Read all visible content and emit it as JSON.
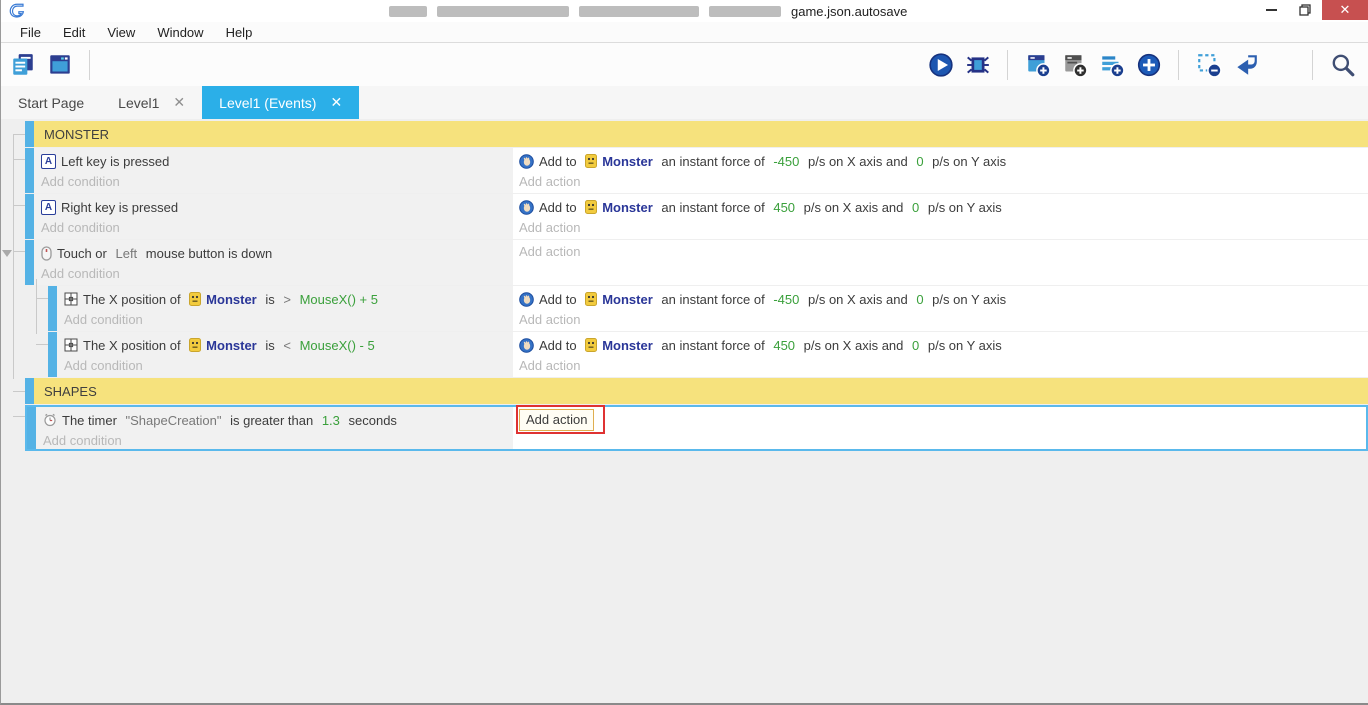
{
  "window": {
    "title_visible": "game.json.autosave",
    "controls": [
      {
        "name": "minimize-button",
        "glyph": "minimize"
      },
      {
        "name": "restore-button",
        "glyph": "restore"
      },
      {
        "name": "close-button",
        "glyph": "close",
        "label": "✕",
        "color": "#c75050"
      }
    ]
  },
  "menu": [
    "File",
    "Edit",
    "View",
    "Window",
    "Help"
  ],
  "toolbar": {
    "left_icons": [
      "project-manager-icon",
      "scene-editor-icon"
    ],
    "right_groups": [
      [
        "play-icon",
        "debug-icon"
      ],
      [
        "add-event-icon",
        "add-subevent-icon",
        "add-comment-icon",
        "add-circle-icon"
      ],
      [
        "remove-selection-icon",
        "undo-icon",
        "redo-icon"
      ],
      [
        "search-icon"
      ]
    ]
  },
  "tabs": [
    {
      "label": "Start Page",
      "closable": false,
      "active": false
    },
    {
      "label": "Level1",
      "closable": true,
      "active": false
    },
    {
      "label": "Level1 (Events)",
      "closable": true,
      "active": true
    }
  ],
  "placeholders": {
    "condition": "Add condition",
    "action": "Add action"
  },
  "colors": {
    "accent_blue": "#2bafe8",
    "event_bar_blue": "#54b2e5",
    "group_yellow": "#f6e27d",
    "value_green": "#3aa03b",
    "object_blue": "#2a3698",
    "annotation_red": "#df3232",
    "close_red": "#c75050"
  },
  "events": {
    "rows": [
      {
        "kind": "group",
        "label": "MONSTER",
        "indent": 0
      },
      {
        "kind": "event",
        "indent": 0,
        "condition": {
          "lines": [
            [
              {
                "icon": "keyboard-a-icon"
              },
              {
                "t": "Left key is pressed"
              }
            ]
          ]
        },
        "action": {
          "lines": [
            [
              {
                "icon": "force-icon"
              },
              {
                "t": "Add to "
              },
              {
                "icon": "monster-icon"
              },
              {
                "t": "Monster",
                "s": "object"
              },
              {
                "t": " an instant force of "
              },
              {
                "t": "-450",
                "s": "value"
              },
              {
                "t": " p/s on X axis and "
              },
              {
                "t": "0",
                "s": "value"
              },
              {
                "t": " p/s on Y axis"
              }
            ]
          ]
        }
      },
      {
        "kind": "event",
        "indent": 0,
        "condition": {
          "lines": [
            [
              {
                "icon": "keyboard-a-icon"
              },
              {
                "t": "Right key is pressed"
              }
            ]
          ]
        },
        "action": {
          "lines": [
            [
              {
                "icon": "force-icon"
              },
              {
                "t": "Add to "
              },
              {
                "icon": "monster-icon"
              },
              {
                "t": "Monster",
                "s": "object"
              },
              {
                "t": " an instant force of "
              },
              {
                "t": "450",
                "s": "value"
              },
              {
                "t": " p/s on X axis and "
              },
              {
                "t": "0",
                "s": "value"
              },
              {
                "t": " p/s on Y axis"
              }
            ]
          ]
        }
      },
      {
        "kind": "event",
        "indent": 0,
        "has_children": true,
        "condition": {
          "lines": [
            [
              {
                "icon": "mouse-icon"
              },
              {
                "t": "Touch or "
              },
              {
                "t": "Left",
                "s": "param"
              },
              {
                "t": " mouse button is down"
              }
            ]
          ]
        },
        "action": {
          "lines": []
        }
      },
      {
        "kind": "event",
        "indent": 1,
        "condition": {
          "lines": [
            [
              {
                "icon": "position-icon"
              },
              {
                "t": "The X position of "
              },
              {
                "icon": "monster-icon"
              },
              {
                "t": "Monster",
                "s": "object"
              },
              {
                "t": " is "
              },
              {
                "t": "> ",
                "s": "param"
              },
              {
                "t": "MouseX() + 5",
                "s": "value"
              }
            ]
          ]
        },
        "action": {
          "lines": [
            [
              {
                "icon": "force-icon"
              },
              {
                "t": "Add to "
              },
              {
                "icon": "monster-icon"
              },
              {
                "t": "Monster",
                "s": "object"
              },
              {
                "t": " an instant force of "
              },
              {
                "t": "-450",
                "s": "value"
              },
              {
                "t": " p/s on X axis and "
              },
              {
                "t": "0",
                "s": "value"
              },
              {
                "t": " p/s on Y axis"
              }
            ]
          ]
        }
      },
      {
        "kind": "event",
        "indent": 1,
        "condition": {
          "lines": [
            [
              {
                "icon": "position-icon"
              },
              {
                "t": "The X position of "
              },
              {
                "icon": "monster-icon"
              },
              {
                "t": "Monster",
                "s": "object"
              },
              {
                "t": " is "
              },
              {
                "t": "< ",
                "s": "param"
              },
              {
                "t": "MouseX() - 5",
                "s": "value"
              }
            ]
          ]
        },
        "action": {
          "lines": [
            [
              {
                "icon": "force-icon"
              },
              {
                "t": "Add to "
              },
              {
                "icon": "monster-icon"
              },
              {
                "t": "Monster",
                "s": "object"
              },
              {
                "t": " an instant force of "
              },
              {
                "t": "450",
                "s": "value"
              },
              {
                "t": " p/s on X axis and "
              },
              {
                "t": "0",
                "s": "value"
              },
              {
                "t": " p/s on Y axis"
              }
            ]
          ]
        }
      },
      {
        "kind": "group",
        "label": "SHAPES",
        "indent": 0
      },
      {
        "kind": "event",
        "indent": 0,
        "selected": true,
        "focused_action": true,
        "annotated": true,
        "condition": {
          "lines": [
            [
              {
                "icon": "timer-icon"
              },
              {
                "t": "The timer "
              },
              {
                "t": "\"ShapeCreation\"",
                "s": "param"
              },
              {
                "t": " is greater than "
              },
              {
                "t": "1.3",
                "s": "value"
              },
              {
                "t": " seconds"
              }
            ]
          ]
        },
        "action": {
          "lines": []
        }
      }
    ]
  }
}
